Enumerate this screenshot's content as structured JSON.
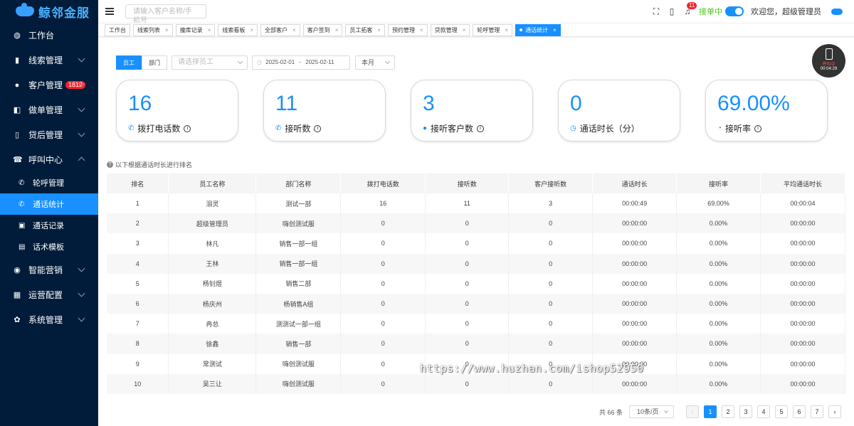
{
  "brand": {
    "name": "鲸邻金服"
  },
  "sidebar": {
    "items": [
      {
        "label": "工作台",
        "icon": "dashboard-icon",
        "glyph": "◍"
      },
      {
        "label": "线索管理",
        "icon": "clue-icon",
        "glyph": "▮"
      },
      {
        "label": "客户管理",
        "icon": "customer-icon",
        "glyph": "●",
        "badge": "1812"
      },
      {
        "label": "做单管理",
        "icon": "order-icon",
        "glyph": "◧"
      },
      {
        "label": "贷后管理",
        "icon": "loan-after-icon",
        "glyph": "▯"
      },
      {
        "label": "呼叫中心",
        "icon": "call-center-icon",
        "glyph": "☎"
      }
    ],
    "sub_items": [
      {
        "label": "轮呼管理",
        "icon": "round-call-icon",
        "glyph": "✆"
      },
      {
        "label": "通话统计",
        "icon": "call-stats-icon",
        "glyph": "✆"
      },
      {
        "label": "通话记录",
        "icon": "call-record-icon",
        "glyph": "▣"
      },
      {
        "label": "话术模板",
        "icon": "script-template-icon",
        "glyph": "▤"
      }
    ],
    "more_items": [
      {
        "label": "智能营销",
        "icon": "marketing-icon",
        "glyph": "◉"
      },
      {
        "label": "运营配置",
        "icon": "ops-config-icon",
        "glyph": "▦"
      },
      {
        "label": "系统管理",
        "icon": "system-icon",
        "glyph": "✿"
      }
    ]
  },
  "header": {
    "search_placeholder": "请输入客户名称/手机号",
    "notification_count": "11",
    "status_label": "接单中",
    "welcome": "欢迎您，超级管理员"
  },
  "tabs": [
    {
      "label": "工作台",
      "closable": false
    },
    {
      "label": "线索列表",
      "closable": true
    },
    {
      "label": "撞库记录",
      "closable": true
    },
    {
      "label": "线索看板",
      "closable": true
    },
    {
      "label": "全部客户",
      "closable": true
    },
    {
      "label": "客户签到",
      "closable": true
    },
    {
      "label": "员工拓客",
      "closable": true
    },
    {
      "label": "预约管理",
      "closable": true
    },
    {
      "label": "贷款管理",
      "closable": true
    },
    {
      "label": "轮呼管理",
      "closable": true
    },
    {
      "label": "通话统计",
      "closable": true,
      "active": true
    }
  ],
  "filter": {
    "seg_employee": "员工",
    "seg_department": "部门",
    "employee_placeholder": "请选择员工",
    "date_start": "2025-02-01",
    "date_sep": "-",
    "date_end": "2025-02-11",
    "period": "本月"
  },
  "phone_widget": {
    "status": "呼叫中",
    "timer": "00:04:29"
  },
  "stats": [
    {
      "value": "16",
      "label": "拨打电话数",
      "icon": "phone-icon",
      "glyph": "✆"
    },
    {
      "value": "11",
      "label": "接听数",
      "icon": "phone-incoming-icon",
      "glyph": "✆"
    },
    {
      "value": "3",
      "label": "接听客户数",
      "icon": "user-icon",
      "glyph": "●"
    },
    {
      "value": "0",
      "label": "通话时长（分）",
      "icon": "clock-icon",
      "glyph": "◷"
    },
    {
      "value": "69.00%",
      "label": "接听率",
      "icon": "pie-icon",
      "glyph": "◔"
    }
  ],
  "note": "以下根据通话时长进行排名",
  "table": {
    "columns": [
      "排名",
      "员工名称",
      "部门名称",
      "拨打电话数",
      "接听数",
      "客户接听数",
      "通话时长",
      "接听率",
      "平均通话时长"
    ],
    "rows": [
      [
        "1",
        "泪灵",
        "测试一部",
        "16",
        "11",
        "3",
        "00:00:49",
        "69.00%",
        "00:00:04"
      ],
      [
        "2",
        "超级管理员",
        "嗨创测试服",
        "0",
        "0",
        "0",
        "00:00:00",
        "0.00%",
        "00:00:00"
      ],
      [
        "3",
        "林凡",
        "销售一部一组",
        "0",
        "0",
        "0",
        "00:00:00",
        "0.00%",
        "00:00:00"
      ],
      [
        "4",
        "王林",
        "销售一部一组",
        "0",
        "0",
        "0",
        "00:00:00",
        "0.00%",
        "00:00:00"
      ],
      [
        "5",
        "杨钊煜",
        "销售二部",
        "0",
        "0",
        "0",
        "00:00:00",
        "0.00%",
        "00:00:00"
      ],
      [
        "6",
        "杨庆州",
        "杨销售A组",
        "0",
        "0",
        "0",
        "00:00:00",
        "0.00%",
        "00:00:00"
      ],
      [
        "7",
        "冉总",
        "测测试一部一组",
        "0",
        "0",
        "0",
        "00:00:00",
        "0.00%",
        "00:00:00"
      ],
      [
        "8",
        "徐鑫",
        "销售一部",
        "0",
        "0",
        "0",
        "00:00:00",
        "0.00%",
        "00:00:00"
      ],
      [
        "9",
        "常测试",
        "嗨创测试服",
        "0",
        "0",
        "0",
        "00:00:00",
        "0.00%",
        "00:00:00"
      ],
      [
        "10",
        "吴三让",
        "嗨创测试服",
        "0",
        "0",
        "0",
        "00:00:00",
        "0.00%",
        "00:00:00"
      ]
    ]
  },
  "watermark": "https://www.huzhan.com/ishop52950",
  "pagination": {
    "total": "共 66 条",
    "page_size": "10条/页",
    "prev": "‹",
    "next": "›",
    "pages": [
      "1",
      "2",
      "3",
      "4",
      "5",
      "6",
      "7"
    ],
    "current": "1"
  },
  "colors": {
    "primary": "#1890ff",
    "sidebar_bg": "#001c3a",
    "status_green": "#52c41a",
    "badge_red": "#f5222d"
  }
}
